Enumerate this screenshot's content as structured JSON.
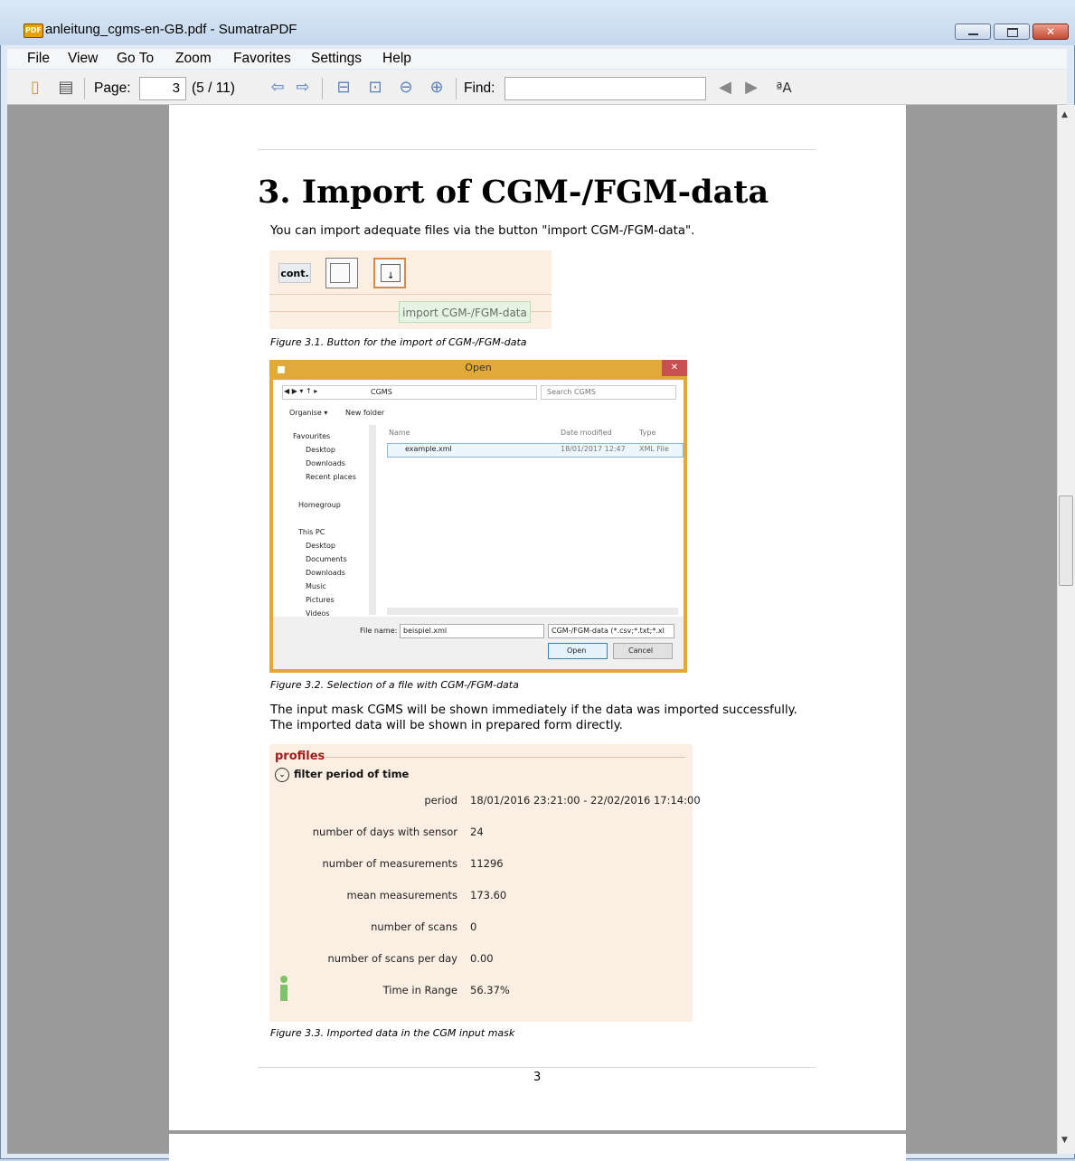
{
  "window": {
    "title": "anleitung_cgms-en-GB.pdf - SumatraPDF",
    "app_icon_label": "PDF"
  },
  "menu": [
    "File",
    "View",
    "Go To",
    "Zoom",
    "Favorites",
    "Settings",
    "Help"
  ],
  "toolbar": {
    "page_label": "Page:",
    "page_value": "3",
    "page_info": "(5 / 11)",
    "find_label": "Find:",
    "find_value": ""
  },
  "document": {
    "heading": "3. Import of CGM-/FGM-data",
    "intro": "You can import adequate files via the button \"import CGM-/FGM-data\".",
    "fig1": {
      "button_cont": "cont.",
      "tooltip": "import CGM-/FGM-data",
      "caption": "Figure 3.1. Button for the import of CGM-/FGM-data"
    },
    "fig2": {
      "dialog_title": "Open",
      "path": "CGMS",
      "search_placeholder": "Search CGMS",
      "organise": "Organise ▾",
      "new_folder": "New folder",
      "nav_items": [
        "Favourites",
        "Desktop",
        "Downloads",
        "Recent places",
        "Homegroup",
        "This PC",
        "Desktop",
        "Documents",
        "Downloads",
        "Music",
        "Pictures",
        "Videos"
      ],
      "columns": [
        "Name",
        "Date modified",
        "Type"
      ],
      "file": {
        "name": "example.xml",
        "date": "18/01/2017 12:47",
        "type": "XML File"
      },
      "file_name_label": "File name:",
      "file_name_value": "beispiel.xml",
      "filter": "CGM-/FGM-data (*.csv;*.txt;*.xl",
      "open_btn": "Open",
      "cancel_btn": "Cancel",
      "caption": "Figure 3.2. Selection of a file with CGM-/FGM-data"
    },
    "paragraph2": "The input mask CGMS will be shown immediately if the data was imported successfully. The imported data will be shown in prepared form directly.",
    "fig3": {
      "section": "profiles",
      "filter": "filter period of time",
      "rows": [
        {
          "label": "period",
          "value": "18/01/2016 23:21:00 - 22/02/2016 17:14:00"
        },
        {
          "label": "number of days with sensor",
          "value": "24"
        },
        {
          "label": "number of measurements",
          "value": "11296"
        },
        {
          "label": "mean measurements",
          "value": "173.60"
        },
        {
          "label": "number of scans",
          "value": "0"
        },
        {
          "label": "number of scans per day",
          "value": "0.00"
        },
        {
          "label": "Time in Range",
          "value": "56.37%"
        }
      ],
      "caption": "Figure 3.3. Imported data in the CGM input mask"
    },
    "page_number": "3"
  }
}
